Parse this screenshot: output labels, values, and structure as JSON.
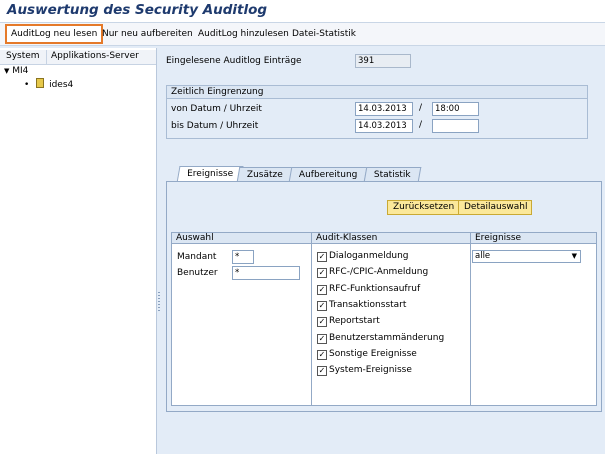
{
  "title": "Auswertung des Security Auditlog",
  "toolbar": {
    "btn1": "AuditLog neu lesen",
    "btn2": "Nur neu aufbereiten",
    "btn3": "AuditLog hinzulesen",
    "btn4": "Datei-Statistik"
  },
  "tree": {
    "col1": "System",
    "col2": "Applikations-Server",
    "root": "MI4",
    "child": "ides4"
  },
  "entries": {
    "label": "Eingelesene Auditlog Einträge",
    "value": "391"
  },
  "zeit": {
    "header": "Zeitlich Eingrenzung",
    "von_label": "von Datum / Uhrzeit",
    "von_date": "14.03.2013",
    "von_time": "18:00",
    "bis_label": "bis Datum / Uhrzeit",
    "bis_date": "14.03.2013",
    "bis_time": "",
    "sep": "/"
  },
  "tabs": [
    "Ereignisse",
    "Zusätze",
    "Aufbereitung",
    "Statistik"
  ],
  "buttons": {
    "reset": "Zurücksetzen",
    "detail": "Detailauswahl"
  },
  "auswahl": {
    "header": "Auswahl",
    "mandant_label": "Mandant",
    "mandant_value": "*",
    "benutzer_label": "Benutzer",
    "benutzer_value": "*"
  },
  "audit": {
    "header": "Audit-Klassen",
    "items": [
      "Dialoganmeldung",
      "RFC-/CPIC-Anmeldung",
      "RFC-Funktionsaufruf",
      "Transaktionsstart",
      "Reportstart",
      "Benutzerstammänderung",
      "Sonstige Ereignisse",
      "System-Ereignisse"
    ],
    "checked_mark": "✓"
  },
  "ereignisse": {
    "header": "Ereignisse",
    "selected": "alle"
  },
  "colors": {
    "accent": "#e57a2a",
    "title": "#1e3a6e",
    "button": "#fbe89a"
  }
}
